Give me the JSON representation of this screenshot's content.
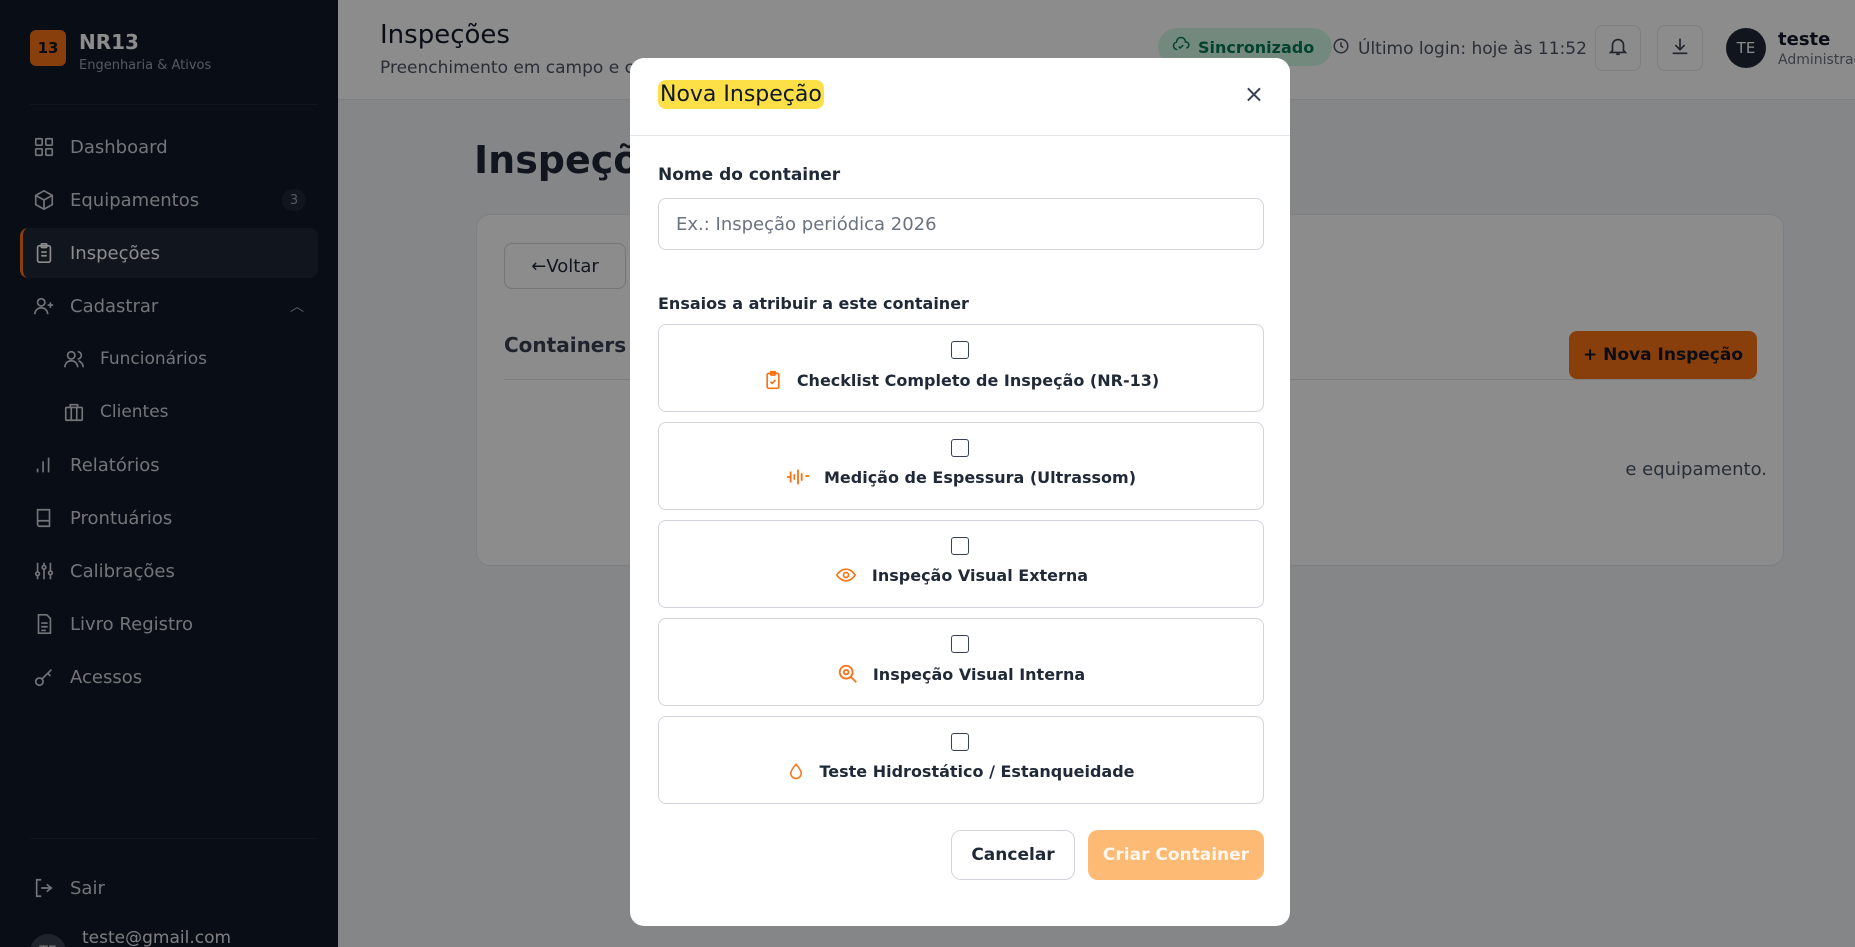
{
  "brand": {
    "logo": "13",
    "name": "NR13",
    "subtitle": "Engenharia & Ativos"
  },
  "sidebar": {
    "items": [
      {
        "label": "Dashboard",
        "icon": "grid-icon"
      },
      {
        "label": "Equipamentos",
        "icon": "box-icon",
        "badge": "3"
      },
      {
        "label": "Inspeções",
        "icon": "clipboard-icon",
        "active": true
      },
      {
        "label": "Cadastrar",
        "icon": "user-plus-icon",
        "expanded": true
      },
      {
        "label": "Funcionários",
        "icon": "users-icon",
        "sub": true
      },
      {
        "label": "Clientes",
        "icon": "building-icon",
        "sub": true
      },
      {
        "label": "Relatórios",
        "icon": "bar-chart-icon"
      },
      {
        "label": "Prontuários",
        "icon": "book-icon"
      },
      {
        "label": "Calibrações",
        "icon": "sliders-icon"
      },
      {
        "label": "Livro Registro",
        "icon": "document-icon"
      },
      {
        "label": "Acessos",
        "icon": "key-icon"
      }
    ],
    "logout_label": "Sair",
    "user_initials": "TE",
    "user_email": "teste@gmail.com"
  },
  "topbar": {
    "title": "Inspeções",
    "subtitle": "Preenchimento em campo e cont",
    "sync_label": "Sincronizado",
    "last_login": "Último login: hoje às 11:52",
    "user_initials": "TE",
    "user_name": "teste",
    "user_role": "Administrad"
  },
  "main": {
    "heading": "Inspeçõe",
    "back_label": "←Voltar",
    "containers_heading": "Containers de",
    "empty_text": "e equipamento.",
    "new_button_label": "+ Nova Inspeção"
  },
  "modal": {
    "title": "Nova Inspeção",
    "close_label": "×",
    "name_label": "Nome do container",
    "name_placeholder": "Ex.: Inspeção periódica 2026",
    "essays_label": "Ensaios a atribuir a este container",
    "essays": [
      {
        "label": "Checklist Completo de Inspeção (NR-13)",
        "icon": "clipboard-check-icon",
        "checked": false
      },
      {
        "label": "Medição de Espessura (Ultrassom)",
        "icon": "waveform-icon",
        "checked": false
      },
      {
        "label": "Inspeção Visual Externa",
        "icon": "eye-icon",
        "checked": false
      },
      {
        "label": "Inspeção Visual Interna",
        "icon": "magnifier-icon",
        "checked": false
      },
      {
        "label": "Teste Hidrostático / Estanqueidade",
        "icon": "droplet-icon",
        "checked": false
      }
    ],
    "cancel_label": "Cancelar",
    "create_label": "Criar Container"
  },
  "colors": {
    "accent": "#f97316",
    "sidebar_bg": "#111827",
    "highlight": "#fde047",
    "sync_bg": "#d1fae5"
  }
}
